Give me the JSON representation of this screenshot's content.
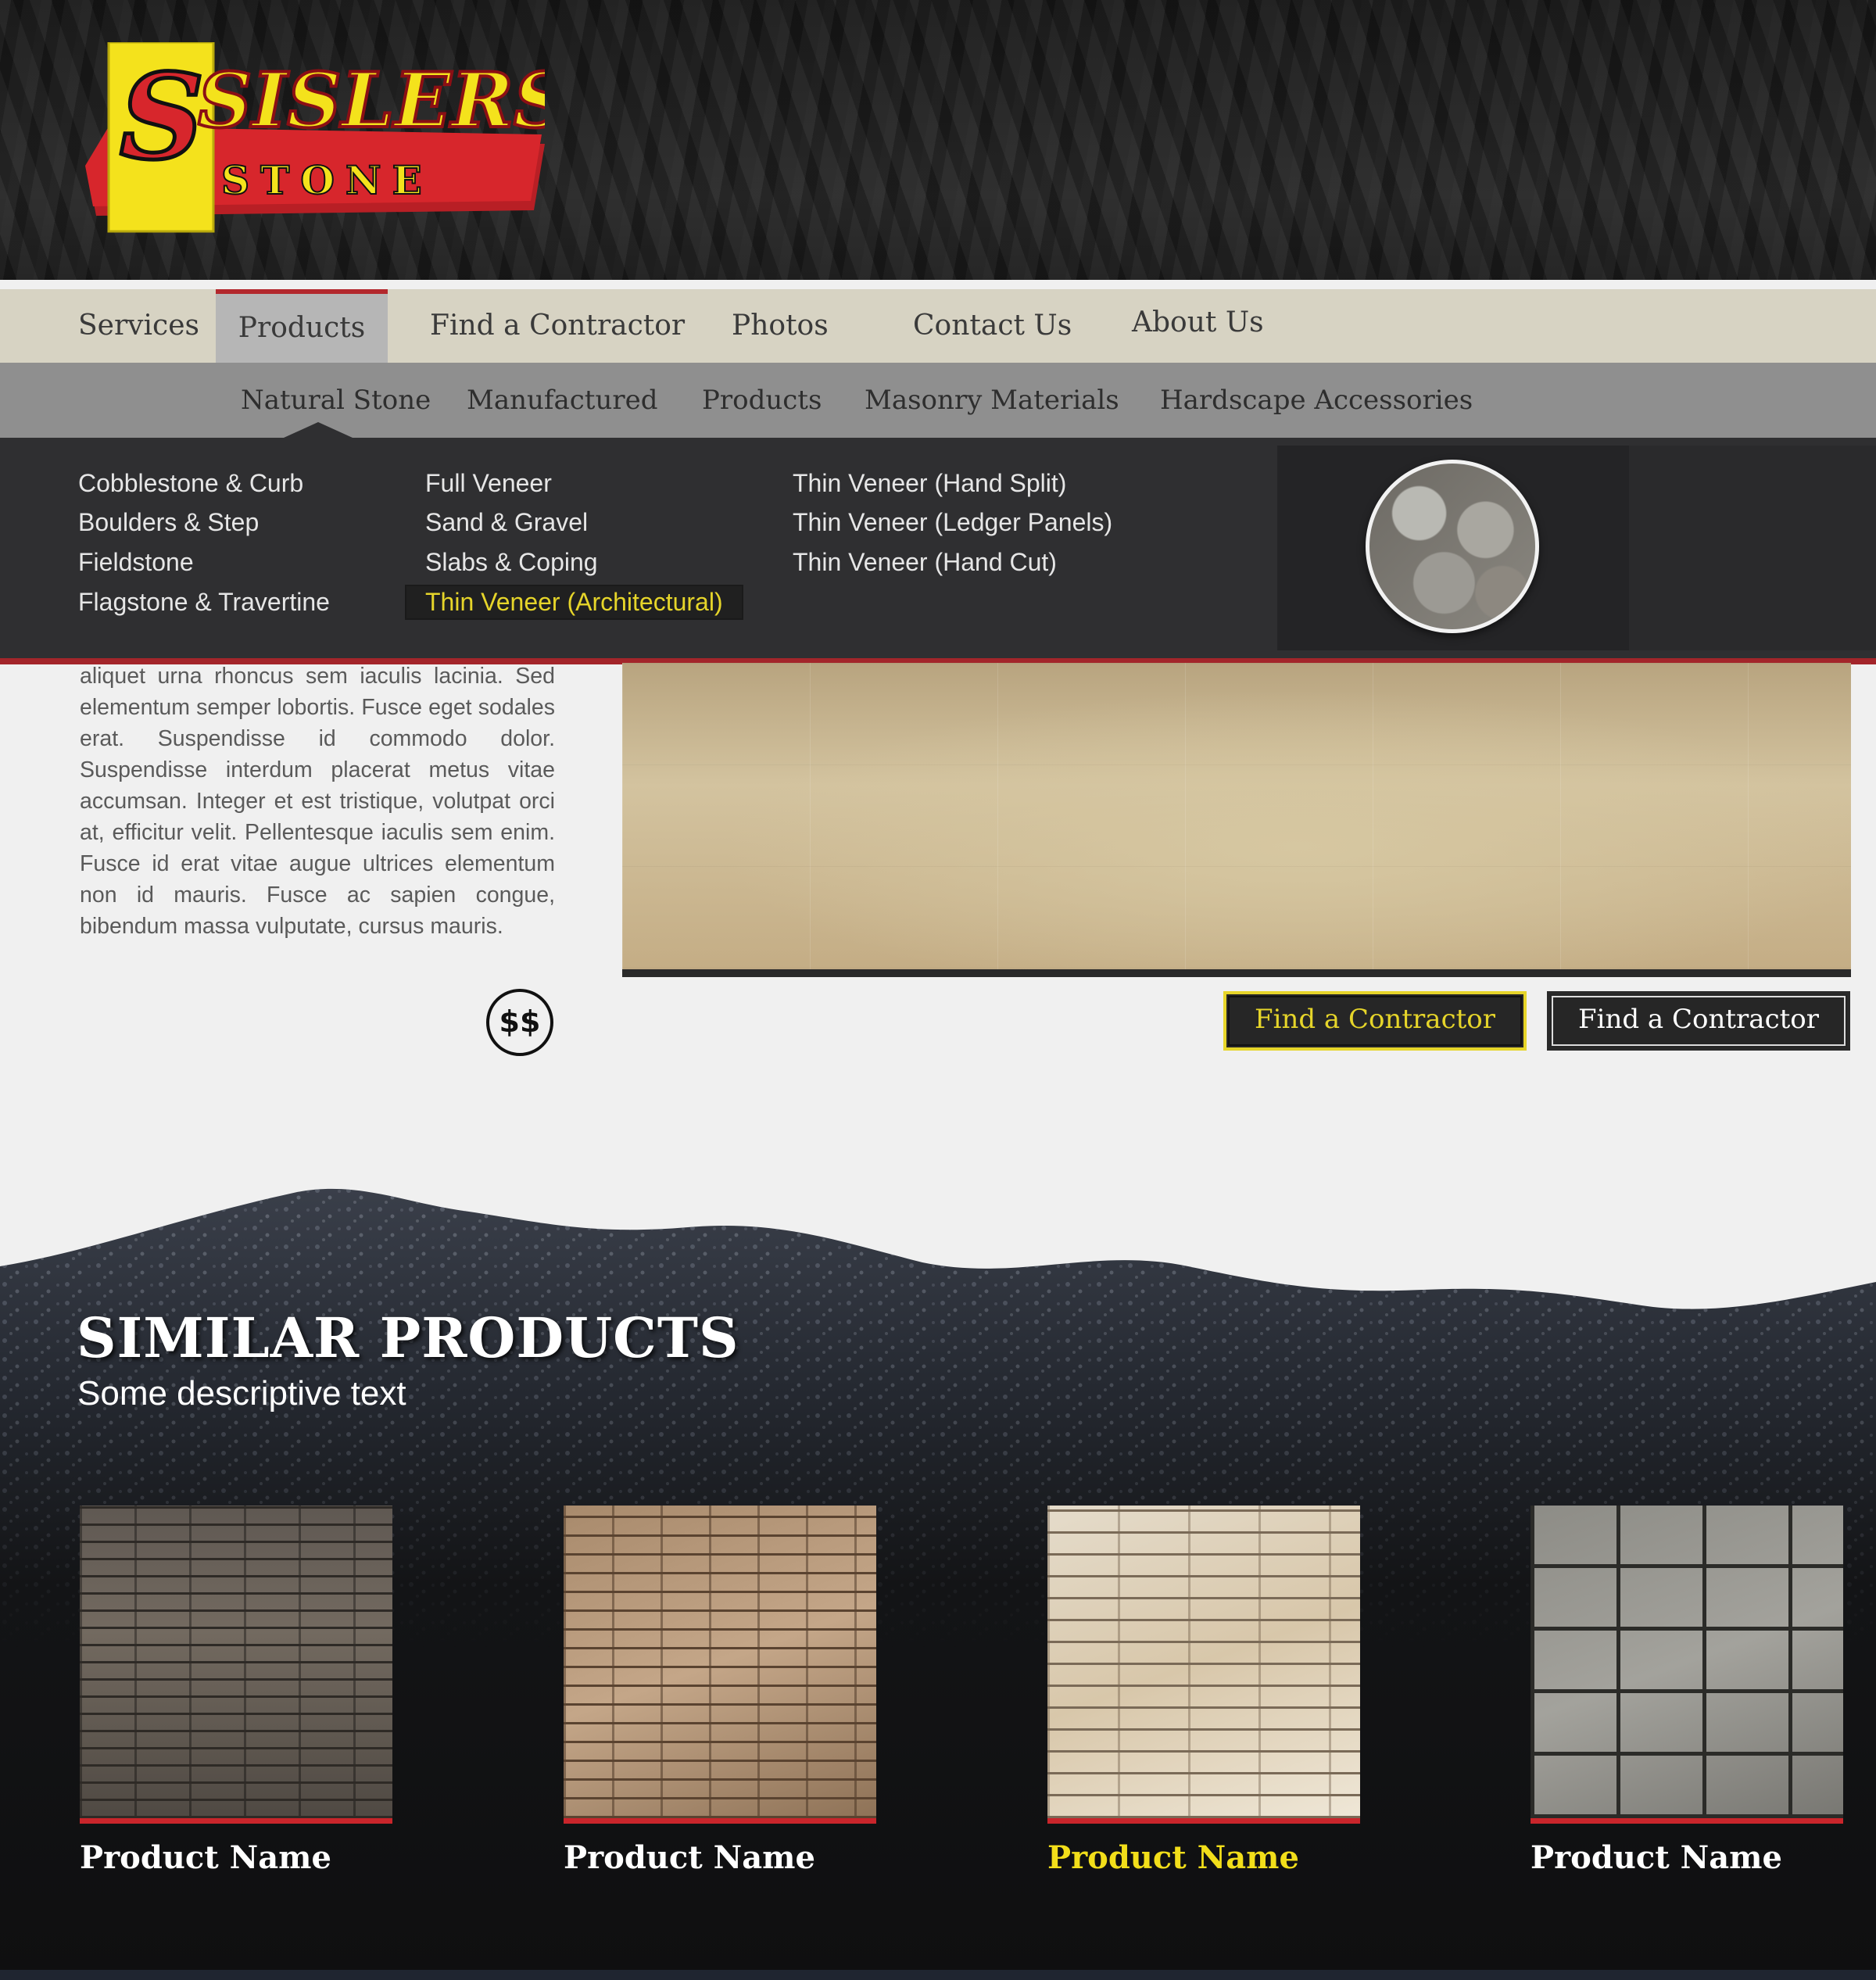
{
  "logo": {
    "line1": "SISLERS",
    "line2": "STONE",
    "colors": {
      "red": "#d7262c",
      "yellow": "#f4e21c",
      "black": "#111111"
    }
  },
  "nav": {
    "items": [
      {
        "label": "Services"
      },
      {
        "label": "Products",
        "active": true
      },
      {
        "label": "Find a Contractor"
      },
      {
        "label": "Photos"
      },
      {
        "label": "Contact Us"
      },
      {
        "label": "About Us"
      }
    ],
    "sub_items": [
      {
        "label": "Natural Stone",
        "active": true
      },
      {
        "label": "Manufactured"
      },
      {
        "label": "Products"
      },
      {
        "label": "Masonry Materials"
      },
      {
        "label": "Hardscape Accessories"
      }
    ]
  },
  "mega_menu": {
    "col1": [
      "Cobblestone & Curb",
      "Boulders & Step",
      "Fieldstone",
      "Flagstone & Travertine"
    ],
    "col2": [
      "Full Veneer",
      "Sand & Gravel",
      "Slabs & Coping",
      "Thin Veneer (Architectural)"
    ],
    "col3": [
      "Thin Veneer (Hand Split)",
      "Thin Veneer (Ledger Panels)",
      "Thin Veneer (Hand Cut)"
    ],
    "highlighted_item": "Thin Veneer (Architectural)"
  },
  "content": {
    "body_text": "aliquet urna rhoncus sem iaculis lacinia. Sed elementum semper lobortis. Fusce eget sodales erat. Suspendisse id commodo dolor. Suspendisse interdum placerat metus vitae accumsan. Integer et est tristique, volutpat orci at, efficitur velit. Pellentesque iaculis sem enim. Fusce id erat vitae augue ultrices elementum non id mauris. Fusce ac sapien congue, bibendum massa vulputate, cursus mauris.",
    "price_badge": "$$",
    "cta_primary": "Find a Contractor",
    "cta_secondary": "Find a Contractor"
  },
  "similar": {
    "title": "SIMILAR PRODUCTS",
    "subtitle": "Some descriptive text",
    "products": [
      {
        "name": "Product Name"
      },
      {
        "name": "Product Name"
      },
      {
        "name": "Product Name",
        "highlight": true
      },
      {
        "name": "Product Name"
      }
    ]
  },
  "colors": {
    "accent_red": "#c9252b",
    "accent_yellow": "#e6d52a",
    "nav_bg": "#d7d3c3",
    "menu_bg": "#2f2f31"
  }
}
